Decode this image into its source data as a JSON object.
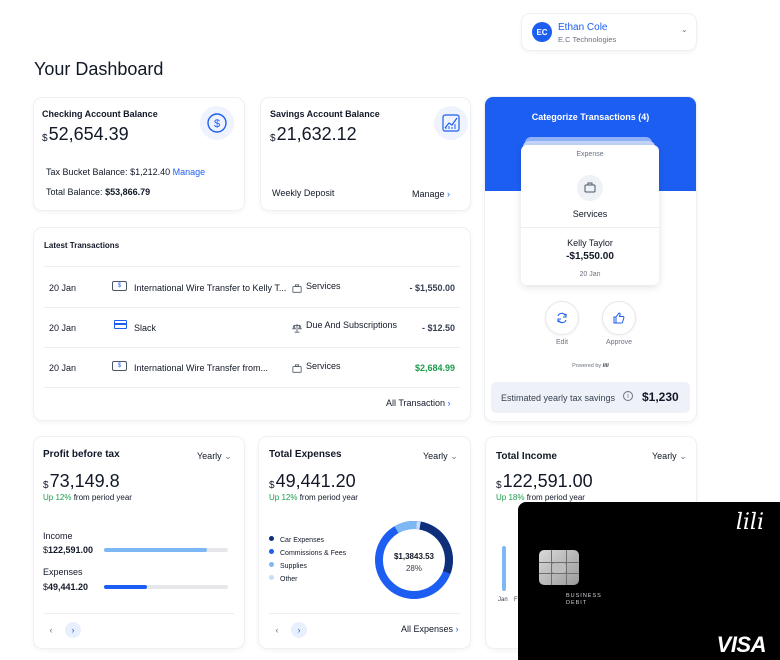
{
  "user": {
    "initials": "EC",
    "name": "Ethan Cole",
    "company": "E.C Technologies"
  },
  "page_title": "Your Dashboard",
  "checking": {
    "title": "Checking Account Balance",
    "currency": "$",
    "amount": "52,654.39",
    "tax_bucket_label": "Tax Bucket Balance:",
    "tax_bucket_value": "$1,212.40",
    "manage": "Manage",
    "total_label": "Total Balance:",
    "total_value": "$53,866.79"
  },
  "savings": {
    "title": "Savings Account Balance",
    "currency": "$",
    "amount": "21,632.12",
    "weekly": "Weekly Deposit",
    "manage": "Manage"
  },
  "categorize": {
    "title": "Categorize Transactions (4)",
    "tag": "Expense",
    "category": "Services",
    "payee": "Kelly Taylor",
    "amount": "-$1,550.00",
    "date": "20 Jan",
    "edit": "Edit",
    "approve": "Approve",
    "powered": "Powered by",
    "estimate_label": "Estimated yearly tax savings",
    "estimate_value": "$1,230"
  },
  "transactions": {
    "title": "Latest Transactions",
    "rows": [
      {
        "date": "20 Jan",
        "desc": "International Wire Transfer to Kelly T...",
        "category": "Services",
        "amount": "- $1,550.00",
        "positive": false
      },
      {
        "date": "20 Jan",
        "desc": "Slack",
        "category": "Due And Subscriptions",
        "amount": "- $12.50",
        "positive": false
      },
      {
        "date": "20 Jan",
        "desc": "International Wire Transfer from...",
        "category": "Services",
        "amount": "$2,684.99",
        "positive": true
      }
    ],
    "all_link": "All Transaction"
  },
  "profit": {
    "title": "Profit before tax",
    "period": "Yearly",
    "currency": "$",
    "amount": "73,149.8",
    "change_up": "Up 12%",
    "change_rest": "from period year",
    "income_label": "Income",
    "income_currency": "$",
    "income_value": "122,591.00",
    "expenses_label": "Expenses",
    "expenses_currency": "$",
    "expenses_value": "49,441.20",
    "income_ratio": 0.83,
    "expenses_ratio": 0.35
  },
  "expenses": {
    "title": "Total Expenses",
    "period": "Yearly",
    "currency": "$",
    "amount": "49,441.20",
    "change_up": "Up 12%",
    "change_rest": "from period year",
    "legend": [
      "Car Expenses",
      "Commissions & Fees",
      "Supplies",
      "Other"
    ],
    "donut_value": "$1,3843.53",
    "donut_percent": "28%",
    "donut_fraction": 0.28,
    "all_link": "All Expenses"
  },
  "income": {
    "title": "Total Income",
    "period": "Yearly",
    "currency": "$",
    "amount": "122,591.00",
    "change_up": "Up 18%",
    "change_rest": "from period year",
    "axis_label": "Jan",
    "axis_label2": "F"
  },
  "card": {
    "brand": "lili",
    "type_line1": "BUSINESS",
    "type_line2": "DEBIT",
    "network": "VISA"
  },
  "colors": {
    "accent": "#1d5ef2",
    "green": "#1a9d4a",
    "light_blue": "#7db8f5",
    "pale_blue": "#c9dcfb"
  }
}
